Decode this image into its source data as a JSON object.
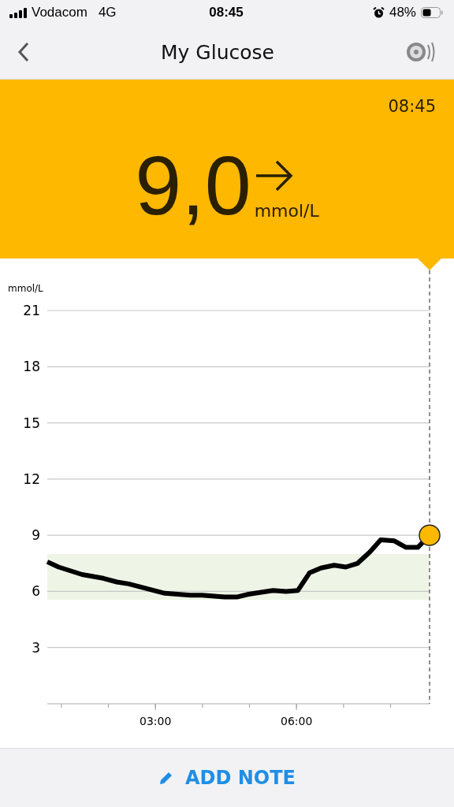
{
  "status_bar": {
    "carrier": "Vodacom",
    "network": "4G",
    "time": "08:45",
    "battery": "48%"
  },
  "nav": {
    "title": "My Glucose"
  },
  "reading": {
    "time": "08:45",
    "value": "9,0",
    "unit": "mmol/L"
  },
  "chart": {
    "chart_data": {
      "type": "line",
      "ylabel": "mmol/L",
      "x": [
        0.7,
        0.94,
        1.44,
        1.89,
        2.18,
        2.43,
        3.2,
        3.74,
        3.99,
        4.47,
        4.73,
        4.98,
        5.5,
        5.78,
        6.03,
        6.28,
        6.52,
        6.8,
        7.05,
        7.3,
        7.56,
        7.79,
        8.08,
        8.33,
        8.58,
        8.83
      ],
      "series": [
        {
          "color": "#000000",
          "values": [
            7.58,
            7.3,
            6.9,
            6.7,
            6.5,
            6.4,
            5.9,
            5.8,
            5.8,
            5.7,
            5.7,
            5.85,
            6.05,
            6.0,
            6.05,
            7.0,
            7.25,
            7.4,
            7.3,
            7.5,
            8.1,
            8.75,
            8.7,
            8.35,
            8.35,
            9.0
          ]
        }
      ],
      "xlim": [
        0.7,
        8.83
      ],
      "ylim": [
        0,
        21
      ],
      "xticks": [
        {
          "value": 3,
          "label": "03:00"
        },
        {
          "value": 6,
          "label": "06:00"
        }
      ],
      "yticks": [
        3,
        6,
        9,
        12,
        15,
        18,
        21
      ],
      "grid": true,
      "bands": [
        {
          "axis": "y",
          "from": 5.55,
          "to": 8.0,
          "color": "#eef5e6"
        }
      ]
    }
  },
  "footer": {
    "button": "ADD NOTE"
  }
}
